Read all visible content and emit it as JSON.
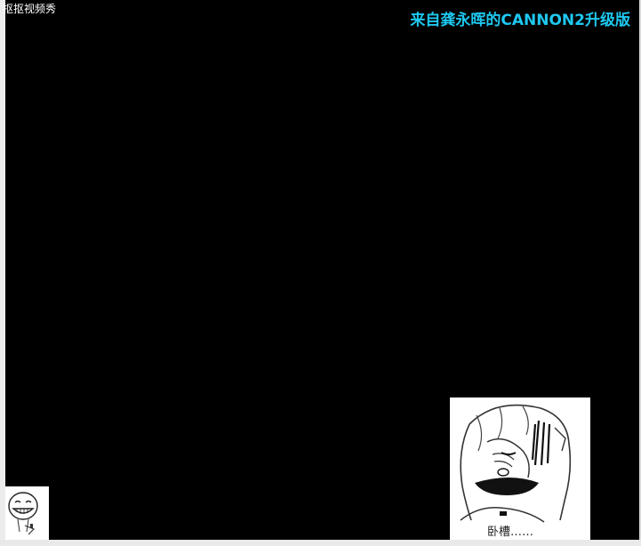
{
  "window": {
    "title": "抠抠视频秀",
    "background_color": "#000000"
  },
  "credit": {
    "text": "来自龚永晖的CANNON2升级版",
    "color": "#1ec8f0"
  },
  "stickers": {
    "small": {
      "icon": "grinning-face-sticker-icon"
    },
    "large": {
      "icon": "facepalm-girl-sticker-icon",
      "caption": "卧槽……"
    }
  }
}
